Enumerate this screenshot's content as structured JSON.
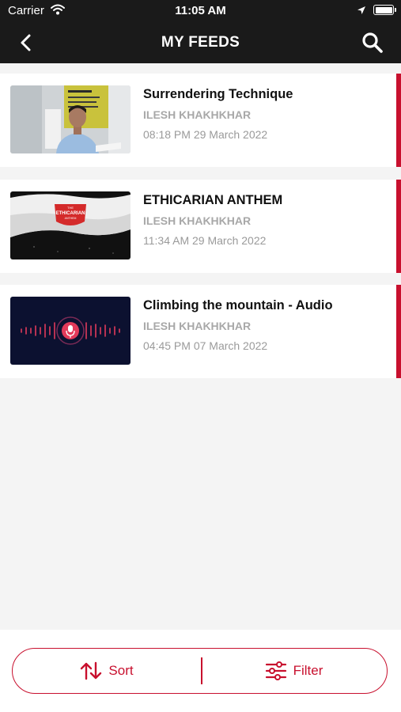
{
  "status_bar": {
    "carrier": "Carrier",
    "time": "11:05 AM"
  },
  "header": {
    "title": "MY FEEDS"
  },
  "feeds": [
    {
      "title": "Surrendering Technique",
      "author": "ILESH KHAKHKHAR",
      "date": "08:18 PM 29 March 2022"
    },
    {
      "title": "ETHICARIAN ANTHEM",
      "author": "ILESH KHAKHKHAR",
      "date": "11:34 AM 29 March 2022",
      "thumb_text": [
        "THE",
        "ETHICARIAN",
        "ANTHEM"
      ]
    },
    {
      "title": "Climbing the mountain - Audio",
      "author": "ILESH KHAKHKHAR",
      "date": "04:45 PM 07 March 2022"
    }
  ],
  "bottom_bar": {
    "sort_label": "Sort",
    "filter_label": "Filter"
  },
  "colors": {
    "accent": "#c8102e",
    "header_bg": "#1a1a1a",
    "page_bg": "#f4f4f4"
  }
}
